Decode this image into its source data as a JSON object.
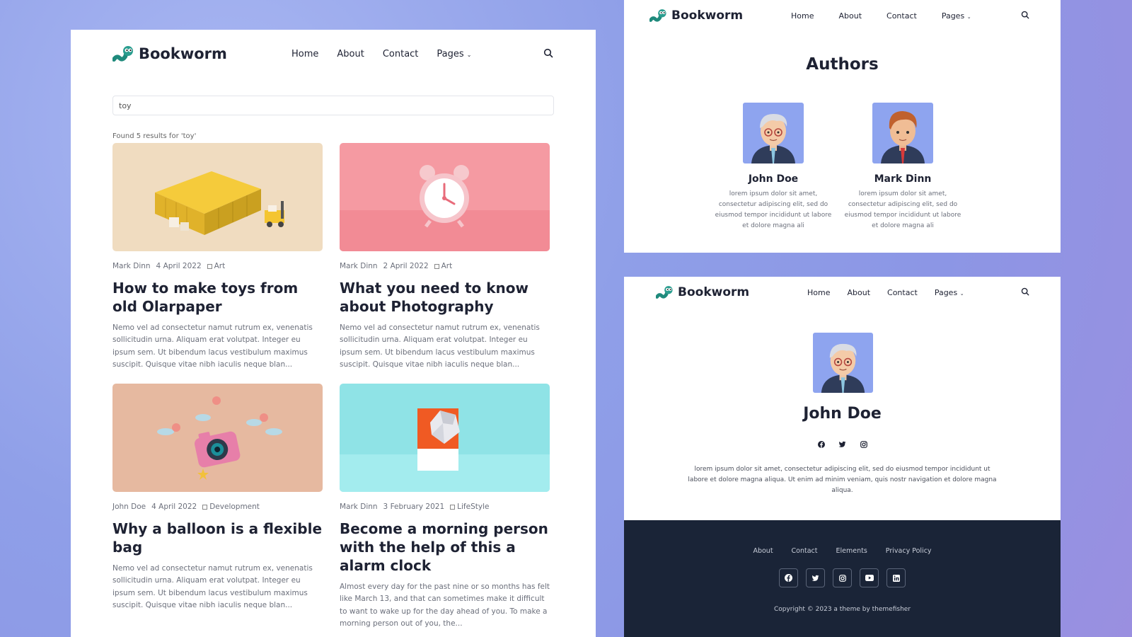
{
  "brand": {
    "name": "Bookworm",
    "accent": "#2a9d8f"
  },
  "nav": {
    "items": [
      "Home",
      "About",
      "Contact",
      "Pages"
    ]
  },
  "search_page": {
    "query": "toy",
    "found_text": "Found 5 results for 'toy'",
    "posts": [
      {
        "author": "Mark Dinn",
        "date": "4 April 2022",
        "category": "Art",
        "title": "How to make toys from old Olarpaper",
        "excerpt": "Nemo vel ad consectetur namut rutrum ex, venenatis sollicitudin urna. Aliquam erat volutpat. Integer eu ipsum sem. Ut bibendum lacus vestibulum maximus suscipit. Quisque vitae nibh iaculis neque blan...",
        "image": "yellow-shipping-container"
      },
      {
        "author": "Mark Dinn",
        "date": "2 April 2022",
        "category": "Art",
        "title": "What you need to know about Photography",
        "excerpt": "Nemo vel ad consectetur namut rutrum ex, venenatis sollicitudin urna. Aliquam erat volutpat. Integer eu ipsum sem. Ut bibendum lacus vestibulum maximus suscipit. Quisque vitae nibh iaculis neque blan...",
        "image": "pink-alarm-clock"
      },
      {
        "author": "John Doe",
        "date": "4 April 2022",
        "category": "Development",
        "title": "Why a balloon is a flexible bag",
        "excerpt": "Nemo vel ad consectetur namut rutrum ex, venenatis sollicitudin urna. Aliquam erat volutpat. Integer eu ipsum sem. Ut bibendum lacus vestibulum maximus suscipit. Quisque vitae nibh iaculis neque blan...",
        "image": "pink-camera-balloons"
      },
      {
        "author": "Mark Dinn",
        "date": "3 February 2021",
        "category": "LifeStyle",
        "title": "Become a morning person with the help of this a alarm clock",
        "excerpt": "Almost every day for the past nine or so months has felt like March 13, and that can sometimes make it difficult to want to wake up for the day ahead of you. To make a morning person out of you, the...",
        "image": "diamond-on-teal"
      }
    ]
  },
  "authors_page": {
    "title": "Authors",
    "authors": [
      {
        "name": "John Doe",
        "bio": "lorem ipsum dolor sit amet, consectetur adipiscing elit, sed do eiusmod tempor incididunt ut labore et dolore magna ali"
      },
      {
        "name": "Mark Dinn",
        "bio": "lorem ipsum dolor sit amet, consectetur adipiscing elit, sed do eiusmod tempor incididunt ut labore et dolore magna ali"
      }
    ]
  },
  "author_page": {
    "name": "John Doe",
    "social": [
      "facebook-icon",
      "twitter-icon",
      "instagram-icon"
    ],
    "bio": "lorem ipsum dolor sit amet, consectetur adipiscing elit, sed do eiusmod tempor incididunt ut labore et dolore magna aliqua. Ut enim ad minim veniam, quis nostr navigation et dolore magna aliqua.",
    "footer": {
      "links": [
        "About",
        "Contact",
        "Elements",
        "Privacy Policy"
      ],
      "social": [
        "facebook-icon",
        "twitter-icon",
        "instagram-icon",
        "youtube-icon",
        "linkedin-icon"
      ],
      "copyright": "Copyright © 2023 a theme by themefisher"
    }
  }
}
